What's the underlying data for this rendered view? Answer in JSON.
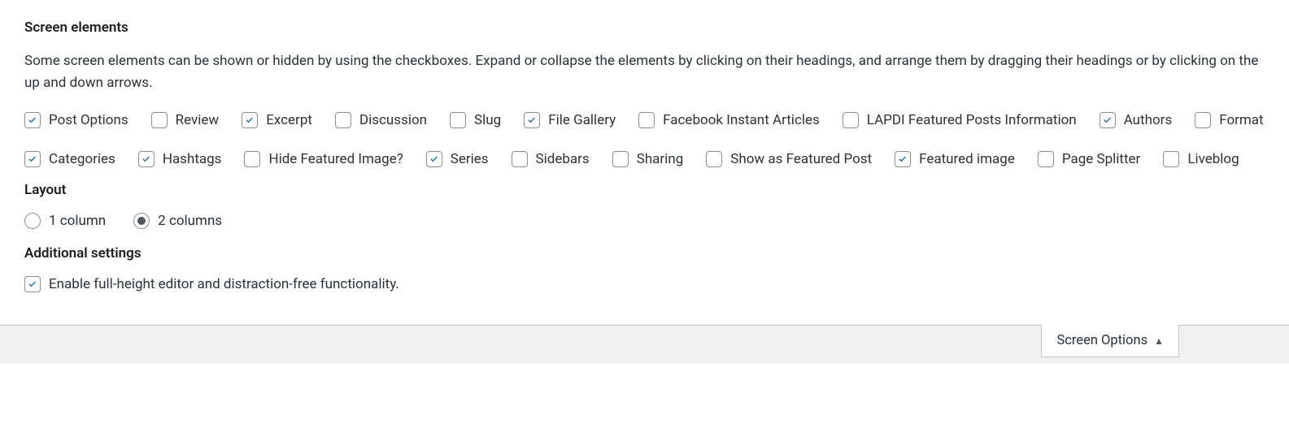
{
  "screenElements": {
    "title": "Screen elements",
    "description": "Some screen elements can be shown or hidden by using the checkboxes. Expand or collapse the elements by clicking on their headings, and arrange them by dragging their headings or by clicking on the up and down arrows.",
    "items": [
      {
        "label": "Post Options",
        "checked": true
      },
      {
        "label": "Review",
        "checked": false
      },
      {
        "label": "Excerpt",
        "checked": true
      },
      {
        "label": "Discussion",
        "checked": false
      },
      {
        "label": "Slug",
        "checked": false
      },
      {
        "label": "File Gallery",
        "checked": true
      },
      {
        "label": "Facebook Instant Articles",
        "checked": false
      },
      {
        "label": "LAPDI Featured Posts Information",
        "checked": false
      },
      {
        "label": "Authors",
        "checked": true
      },
      {
        "label": "Format",
        "checked": false
      },
      {
        "label": "Categories",
        "checked": true
      },
      {
        "label": "Hashtags",
        "checked": true
      },
      {
        "label": "Hide Featured Image?",
        "checked": false
      },
      {
        "label": "Series",
        "checked": true
      },
      {
        "label": "Sidebars",
        "checked": false
      },
      {
        "label": "Sharing",
        "checked": false
      },
      {
        "label": "Show as Featured Post",
        "checked": false
      },
      {
        "label": "Featured image",
        "checked": true
      },
      {
        "label": "Page Splitter",
        "checked": false
      },
      {
        "label": "Liveblog",
        "checked": false
      }
    ]
  },
  "layout": {
    "title": "Layout",
    "options": [
      {
        "label": "1 column",
        "selected": false
      },
      {
        "label": "2 columns",
        "selected": true
      }
    ]
  },
  "additional": {
    "title": "Additional settings",
    "items": [
      {
        "label": "Enable full-height editor and distraction-free functionality.",
        "checked": true
      }
    ]
  },
  "tab": {
    "label": "Screen Options"
  }
}
